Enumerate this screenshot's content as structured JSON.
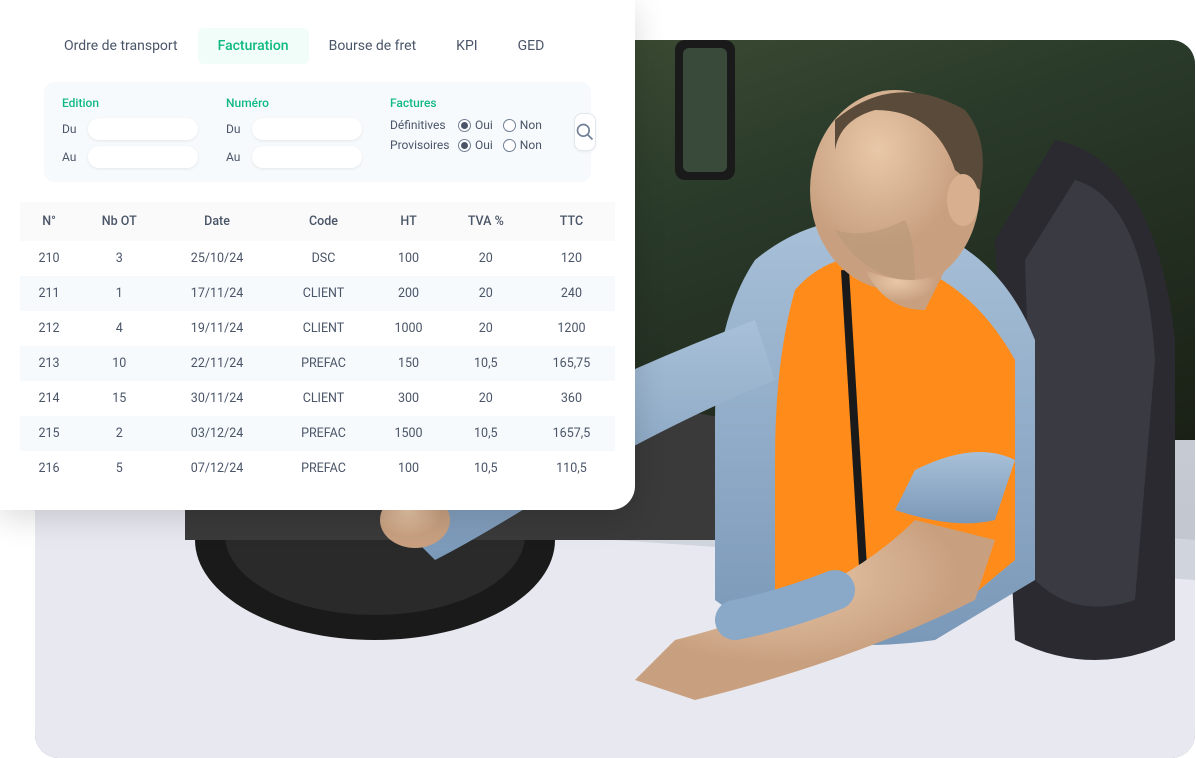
{
  "tabs": [
    {
      "id": "ordre",
      "label": "Ordre de transport",
      "active": false
    },
    {
      "id": "facturation",
      "label": "Facturation",
      "active": true
    },
    {
      "id": "bourse",
      "label": "Bourse de fret",
      "active": false
    },
    {
      "id": "kpi",
      "label": "KPI",
      "active": false
    },
    {
      "id": "ged",
      "label": "GED",
      "active": false
    }
  ],
  "filters": {
    "edition": {
      "title": "Edition",
      "du_label": "Du",
      "au_label": "Au",
      "du_value": "",
      "au_value": ""
    },
    "numero": {
      "title": "Numéro",
      "du_label": "Du",
      "au_label": "Au",
      "du_value": "",
      "au_value": ""
    },
    "factures": {
      "title": "Factures",
      "definitives_label": "Définitives",
      "provisoires_label": "Provisoires",
      "oui_label": "Oui",
      "non_label": "Non",
      "definitives_value": "Oui",
      "provisoires_value": "Oui"
    }
  },
  "table": {
    "headers": [
      "N°",
      "Nb OT",
      "Date",
      "Code",
      "HT",
      "TVA %",
      "TTC"
    ],
    "rows": [
      {
        "n": "210",
        "nb_ot": "3",
        "date": "25/10/24",
        "code": "DSC",
        "ht": "100",
        "tva": "20",
        "ttc": "120",
        "link": false
      },
      {
        "n": "211",
        "nb_ot": "1",
        "date": "17/11/24",
        "code": "CLIENT",
        "ht": "200",
        "tva": "20",
        "ttc": "240",
        "link": false
      },
      {
        "n": "212",
        "nb_ot": "4",
        "date": "19/11/24",
        "code": "CLIENT",
        "ht": "1000",
        "tva": "20",
        "ttc": "1200",
        "link": false
      },
      {
        "n": "213",
        "nb_ot": "10",
        "date": "22/11/24",
        "code": "PREFAC",
        "ht": "150",
        "tva": "10,5",
        "ttc": "165,75",
        "link": false
      },
      {
        "n": "214",
        "nb_ot": "15",
        "date": "30/11/24",
        "code": "CLIENT",
        "ht": "300",
        "tva": "20",
        "ttc": "360",
        "link": false
      },
      {
        "n": "215",
        "nb_ot": "2",
        "date": "03/12/24",
        "code": "PREFAC",
        "ht": "1500",
        "tva": "10,5",
        "ttc": "1657,5",
        "link": true
      },
      {
        "n": "216",
        "nb_ot": "5",
        "date": "07/12/24",
        "code": "PREFAC",
        "ht": "100",
        "tva": "10,5",
        "ttc": "110,5",
        "link": false
      }
    ]
  }
}
